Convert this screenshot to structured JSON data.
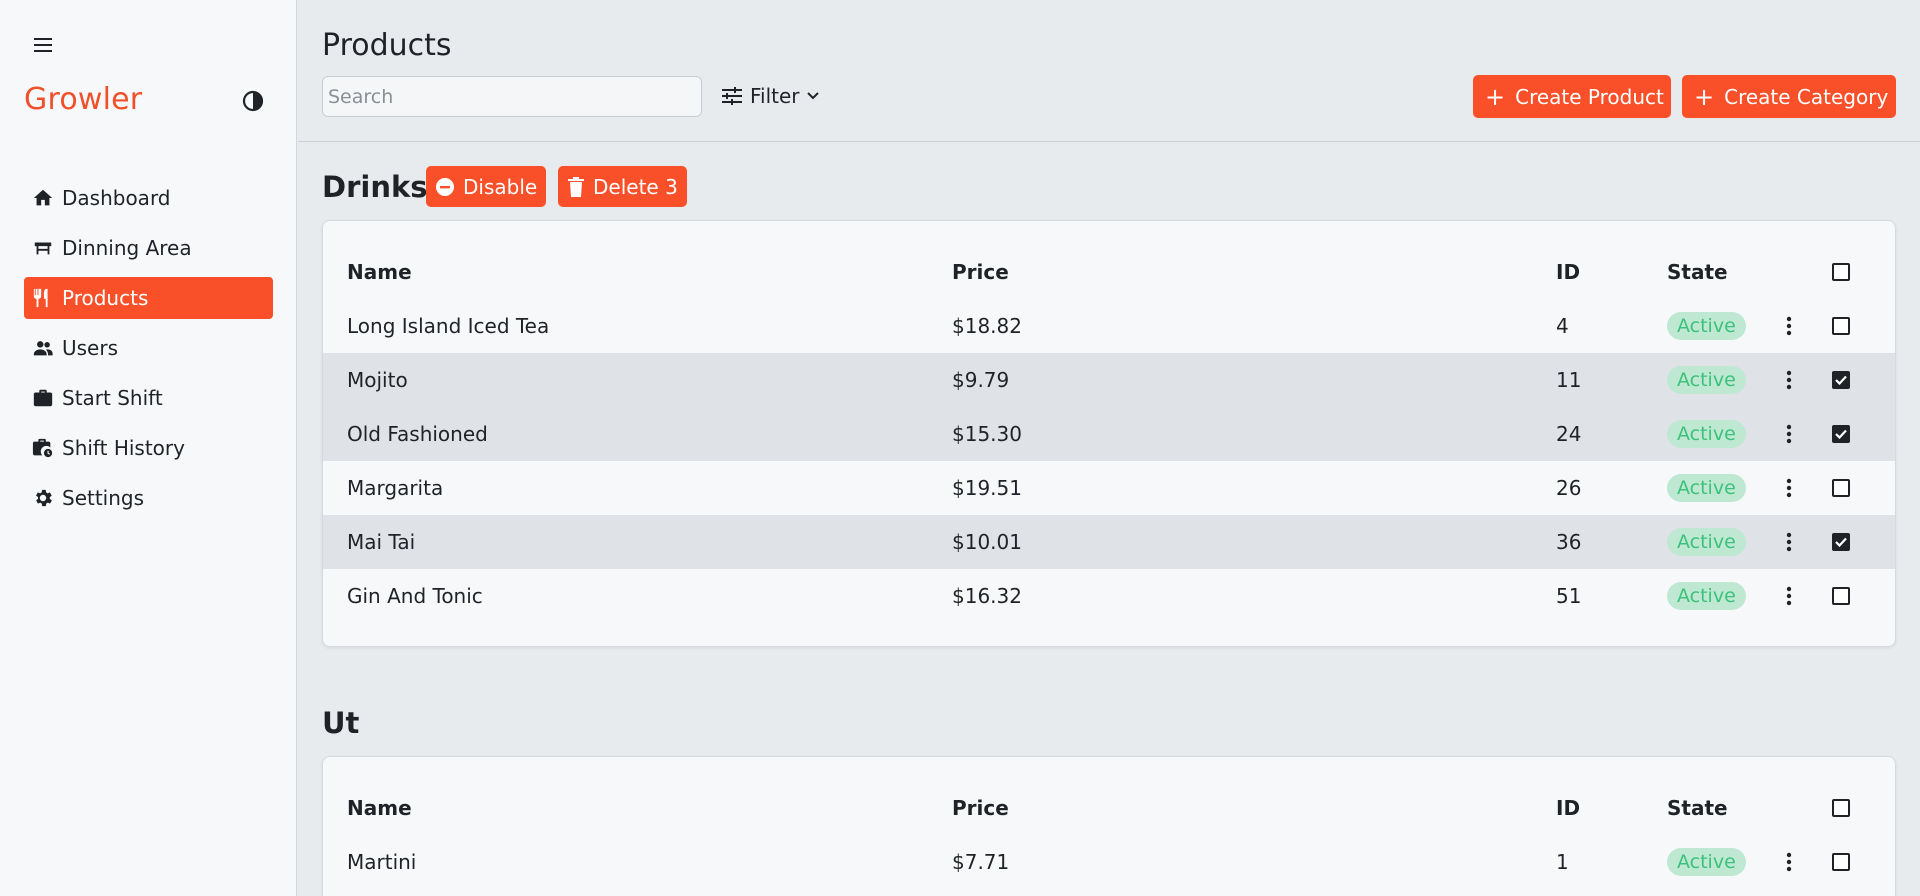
{
  "app": {
    "name": "Growler"
  },
  "sidebar": {
    "items": [
      {
        "label": "Dashboard",
        "icon": "home-icon"
      },
      {
        "label": "Dinning Area",
        "icon": "table-icon"
      },
      {
        "label": "Products",
        "icon": "utensils-icon",
        "active": true
      },
      {
        "label": "Users",
        "icon": "users-icon"
      },
      {
        "label": "Start Shift",
        "icon": "briefcase-icon"
      },
      {
        "label": "Shift History",
        "icon": "briefcase-clock-icon"
      },
      {
        "label": "Settings",
        "icon": "gear-icon"
      }
    ]
  },
  "header": {
    "title": "Products",
    "search_placeholder": "Search",
    "filter_label": "Filter",
    "create_product_label": "Create Product",
    "create_category_label": "Create Category"
  },
  "columns": {
    "name": "Name",
    "price": "Price",
    "id": "ID",
    "state": "State"
  },
  "categories": [
    {
      "title": "Drinks",
      "disable_label": "Disable",
      "delete_label": "Delete 3",
      "rows": [
        {
          "name": "Long Island Iced Tea",
          "price": "$18.82",
          "id": "4",
          "state": "Active",
          "checked": false
        },
        {
          "name": "Mojito",
          "price": "$9.79",
          "id": "11",
          "state": "Active",
          "checked": true
        },
        {
          "name": "Old Fashioned",
          "price": "$15.30",
          "id": "24",
          "state": "Active",
          "checked": true
        },
        {
          "name": "Margarita",
          "price": "$19.51",
          "id": "26",
          "state": "Active",
          "checked": false
        },
        {
          "name": "Mai Tai",
          "price": "$10.01",
          "id": "36",
          "state": "Active",
          "checked": true
        },
        {
          "name": "Gin And Tonic",
          "price": "$16.32",
          "id": "51",
          "state": "Active",
          "checked": false
        }
      ]
    },
    {
      "title": "Ut",
      "rows": [
        {
          "name": "Martini",
          "price": "$7.71",
          "id": "1",
          "state": "Active",
          "checked": false
        }
      ]
    }
  ],
  "colors": {
    "accent": "#f9502a",
    "brand": "#f0502a",
    "badge_bg": "#bfe8d2",
    "badge_text": "#3cc27a",
    "selected_row": "#dfe2e6"
  }
}
